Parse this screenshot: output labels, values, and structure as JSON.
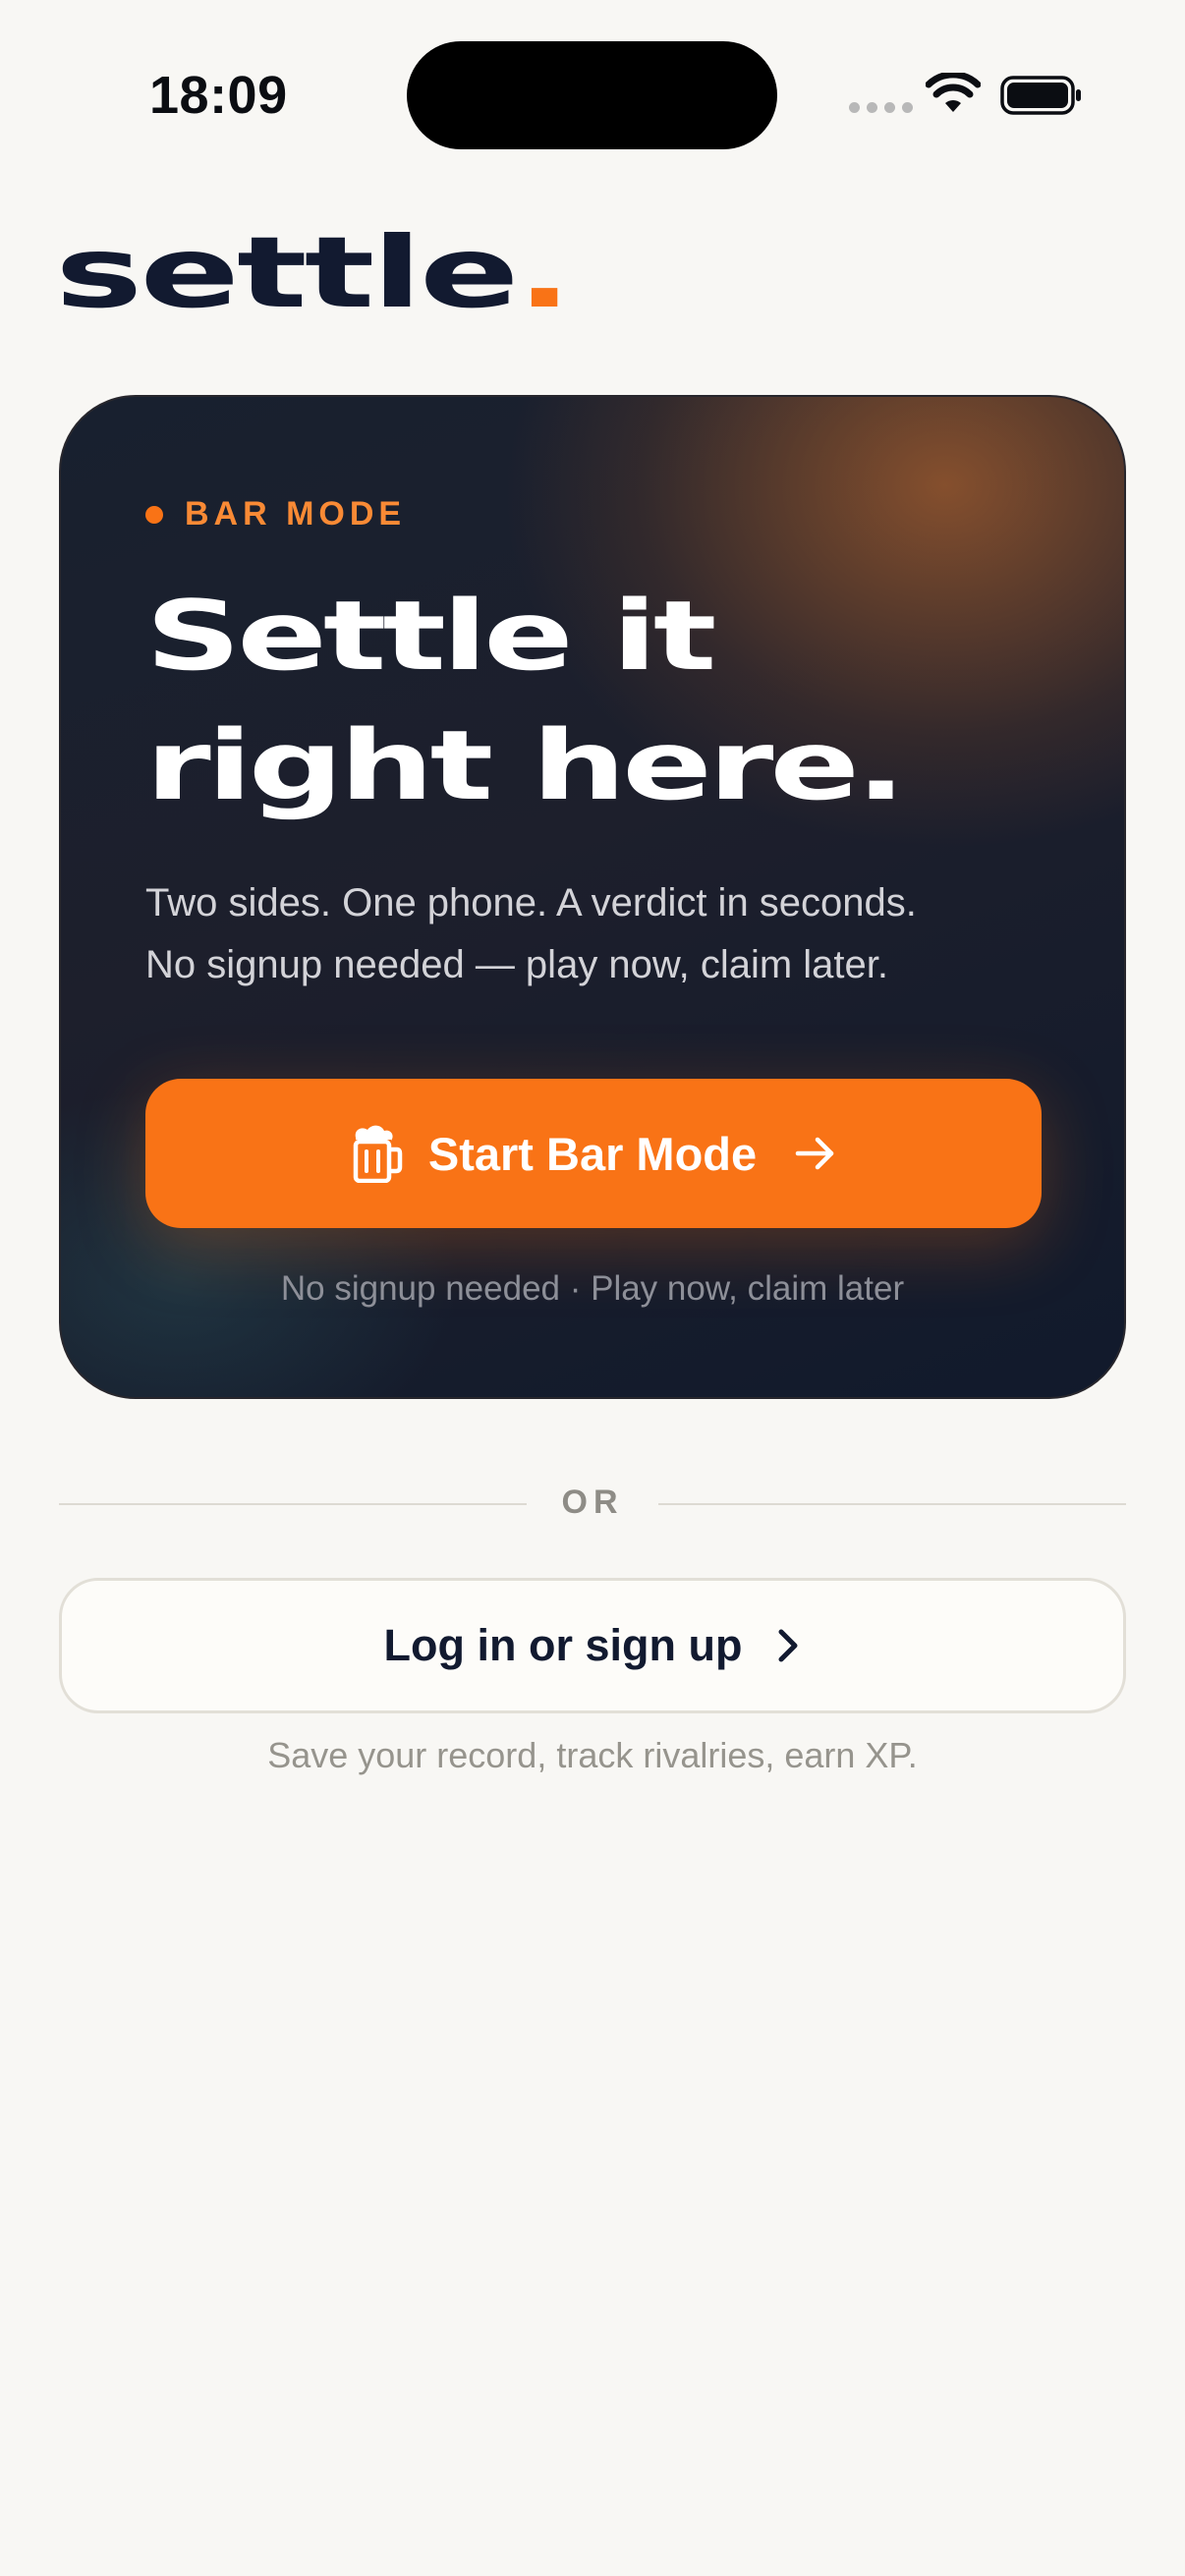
{
  "status_bar": {
    "time": "18:09"
  },
  "brand": {
    "name": "settle",
    "dot": ".",
    "accent_color": "#f97316",
    "text_color": "#121a30"
  },
  "hero": {
    "eyebrow": "BAR MODE",
    "headline": "Settle it\nright here.",
    "subtext": "Two sides. One phone. A verdict in seconds.\nNo signup needed — play now, claim later.",
    "primary_button": {
      "label": "Start Bar Mode",
      "leading_icon": "beer-mug-icon",
      "trailing_icon": "arrow-right-icon"
    },
    "footnote": "No signup needed · Play now, claim later"
  },
  "divider": {
    "label": "OR"
  },
  "login": {
    "button_label": "Log in or sign up",
    "trailing_icon": "chevron-right-icon",
    "caption": "Save your record, track rivalries, earn XP."
  }
}
